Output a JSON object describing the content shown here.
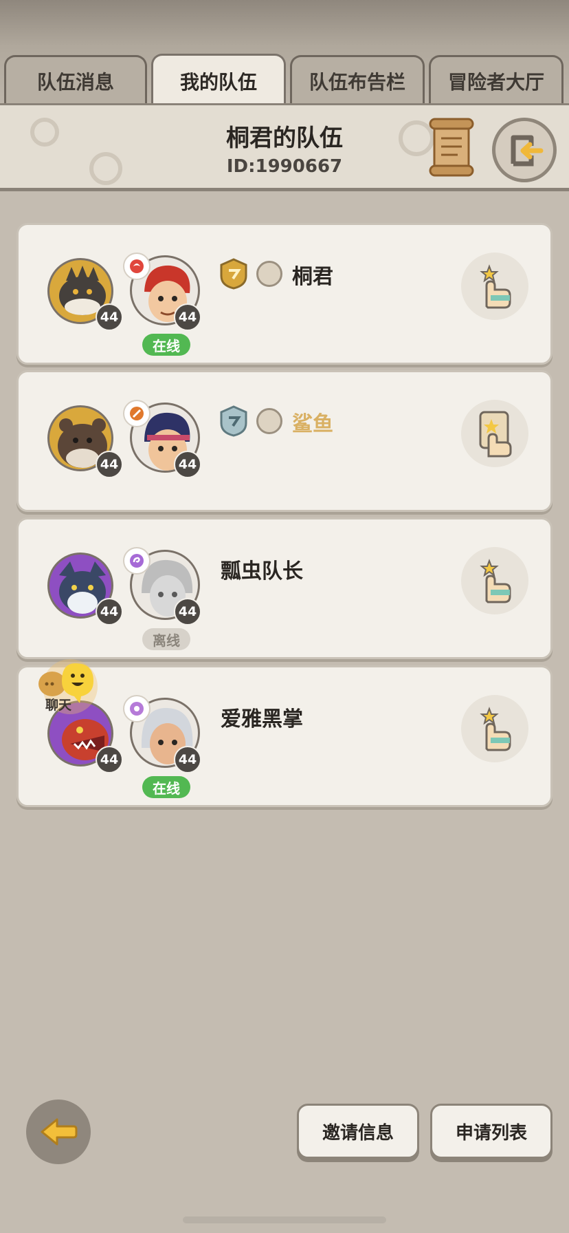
{
  "tabs": [
    {
      "label": "队伍消息"
    },
    {
      "label": "我的队伍"
    },
    {
      "label": "队伍布告栏"
    },
    {
      "label": "冒险者大厅"
    }
  ],
  "header": {
    "title": "桐君的队伍",
    "team_id": "ID:1990667"
  },
  "members": [
    {
      "name": "桐君",
      "pet_level": "44",
      "hero_level": "44",
      "status": "在线"
    },
    {
      "name": "鲨鱼",
      "pet_level": "44",
      "hero_level": "44",
      "status": ""
    },
    {
      "name": "瓢虫队长",
      "pet_level": "44",
      "hero_level": "44",
      "status": "离线"
    },
    {
      "name": "爱雅黑掌",
      "pet_level": "44",
      "hero_level": "44",
      "status": "在线"
    }
  ],
  "chat": {
    "label": "聊天"
  },
  "bottom": {
    "invite_label": "邀请信息",
    "apply_label": "申请列表"
  },
  "colors": {
    "online": "#52b852",
    "offline": "#d7d2ca",
    "gold_name": "#d9b063",
    "background": "#c4bcb1"
  }
}
